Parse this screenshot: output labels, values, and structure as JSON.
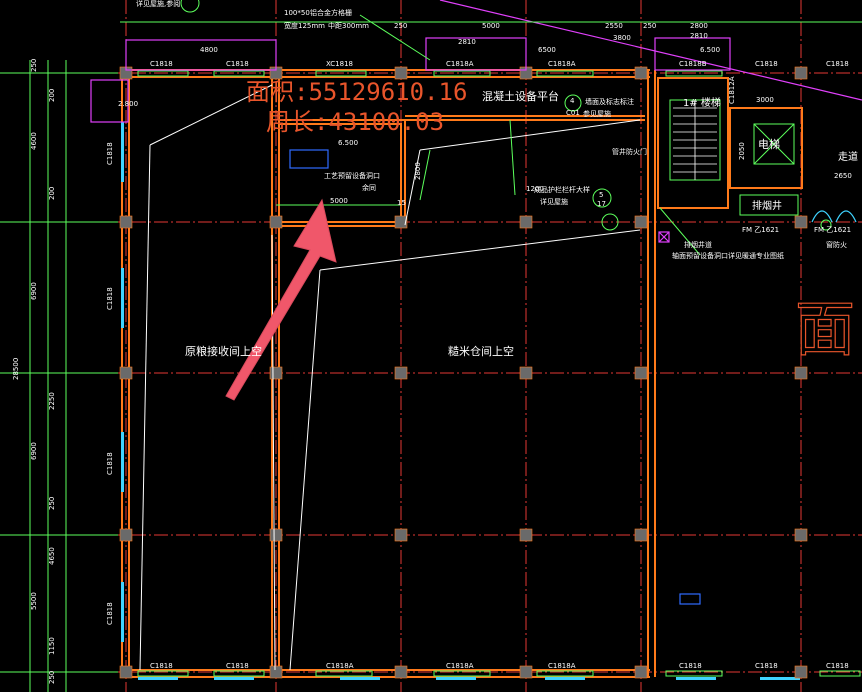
{
  "measure": {
    "area_label": "面积:55129610.16",
    "perimeter_label": "周长:43100.03"
  },
  "rooms": {
    "raw_grain_receiving_above": "原粮接收间上空",
    "rice_storage_above": "糙米仓间上空",
    "concrete_platform": "混凝土设备平台",
    "stairwell": "1# 楼梯",
    "elevator": "电梯",
    "corridor": "走道",
    "shaft": "排烟井",
    "partial_right_char": "面"
  },
  "window_labels": {
    "c1818": "C1818",
    "c1818a": "C1818A",
    "c1818b": "C1818B",
    "xc1818": "XC1818",
    "c1812a": "C1812A"
  },
  "notes": {
    "top_note_1": "详见屋施,参阅",
    "top_note_2a": "100*50",
    "top_note_2b": "铝合金方格栅",
    "top_note_3": "宽度125mm",
    "top_note_4": "中距300mm",
    "equipment_hole": "工艺预留设备洞口",
    "hole_note": "余同",
    "wall_platform_note": "墙面及标志标注",
    "stair_note": "参见屋施",
    "fire_door": "管井防火门",
    "railing_note": "成品护栏栏杆大样",
    "railing_ref": "详见屋施",
    "shaft_note_1": "排烟井道",
    "shaft_note_2": "轴面预留设备洞口详见暖通专业图纸",
    "fm_1": "FM 乙1621",
    "fm_2": "FM 乙1621",
    "fire_window": "窗防火",
    "ref_5": "5",
    "ref_17": "17",
    "ref_4": "4",
    "ref_c01": "C01"
  },
  "dimensions": {
    "top": [
      "4800",
      "250",
      "2810",
      "6500",
      "5000",
      "250",
      "2810",
      "6500",
      "2550",
      "3800",
      "2800"
    ],
    "left": [
      "250",
      "200",
      "4600",
      "200",
      "6900",
      "2250",
      "6900",
      "250",
      "4650",
      "5500",
      "1150",
      "250"
    ],
    "left_total": "28500",
    "elev_1": "6.500",
    "elev_2": "6.500",
    "hole_width": "5000",
    "hole_h": "2800",
    "wall_1200": "1200",
    "stair_3000": "3000",
    "stair_2650": "2650",
    "lift_2050": "2050",
    "small_2800": "2.800",
    "small_1800": "2.800",
    "right_2650": "2650",
    "hole_15": "15"
  },
  "colors": {
    "background": "#000000",
    "axis": "#e53935",
    "wall_orange": "#ff7a1a",
    "green": "#5cff5c",
    "cyan": "#3fd3ff",
    "magenta": "#e040fb",
    "white": "#ffffff",
    "arrow": "#f0576a",
    "column": "#6a6a6a"
  }
}
